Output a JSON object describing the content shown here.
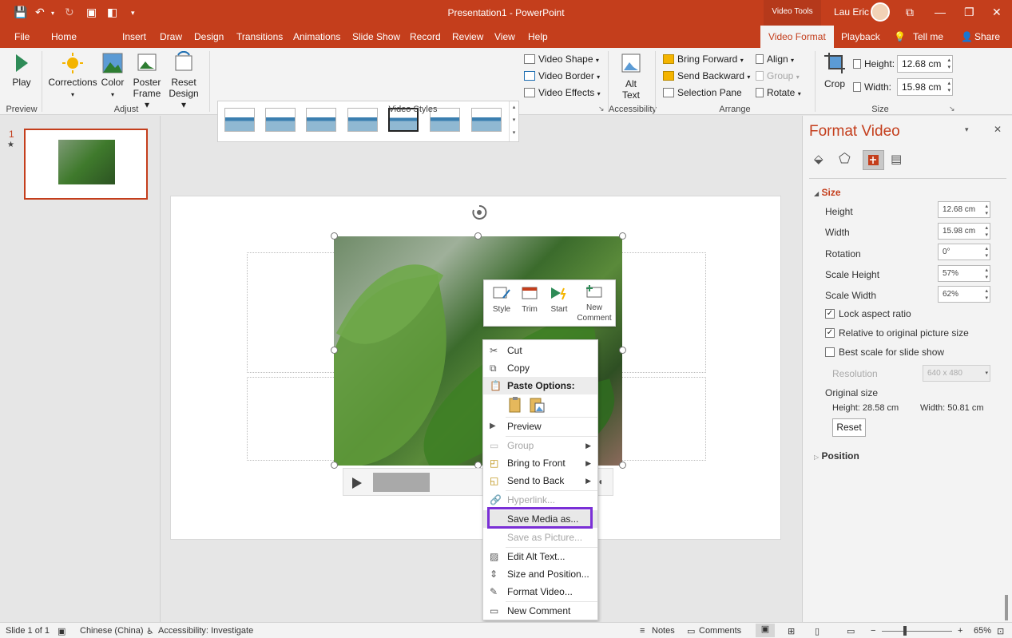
{
  "titlebar": {
    "title": "Presentation1  -  PowerPoint",
    "tools_label": "Video Tools",
    "user": "Lau Eric"
  },
  "tabs": [
    "File",
    "Home",
    "Insert",
    "Draw",
    "Design",
    "Transitions",
    "Animations",
    "Slide Show",
    "Record",
    "Review",
    "View",
    "Help"
  ],
  "tabs_right": {
    "video_format": "Video Format",
    "playback": "Playback",
    "tell_me": "Tell me",
    "share": "Share"
  },
  "ribbon": {
    "preview": {
      "play": "Play",
      "group": "Preview"
    },
    "adjust": {
      "corrections": "Corrections",
      "color": "Color",
      "poster_frame_1": "Poster",
      "poster_frame_2": "Frame",
      "reset_design_1": "Reset",
      "reset_design_2": "Design",
      "group": "Adjust"
    },
    "video_styles": {
      "group": "Video Styles",
      "video_shape": "Video Shape",
      "video_border": "Video Border",
      "video_effects": "Video Effects"
    },
    "accessibility": {
      "alt_text_1": "Alt",
      "alt_text_2": "Text",
      "group": "Accessibility"
    },
    "arrange": {
      "bring_forward": "Bring Forward",
      "send_backward": "Send Backward",
      "selection_pane": "Selection Pane",
      "align": "Align",
      "group_btn": "Group",
      "rotate": "Rotate",
      "group": "Arrange"
    },
    "size": {
      "crop": "Crop",
      "height_label": "Height:",
      "height_value": "12.68 cm",
      "width_label": "Width:",
      "width_value": "15.98 cm",
      "group": "Size"
    }
  },
  "thumbnails": {
    "slide_number": "1",
    "star": "★"
  },
  "mini_toolbar": {
    "style": "Style",
    "trim": "Trim",
    "start": "Start",
    "new_comment_1": "New",
    "new_comment_2": "Comment"
  },
  "context_menu": {
    "cut": "Cut",
    "copy": "Copy",
    "paste_options": "Paste Options:",
    "preview": "Preview",
    "group": "Group",
    "bring_to_front": "Bring to Front",
    "send_to_back": "Send to Back",
    "hyperlink": "Hyperlink...",
    "save_media_as": "Save Media as...",
    "save_as_picture": "Save as Picture...",
    "edit_alt_text": "Edit Alt Text...",
    "size_and_position": "Size and Position...",
    "format_video": "Format Video...",
    "new_comment": "New Comment"
  },
  "format_pane": {
    "title": "Format Video",
    "size_section": "Size",
    "height_label": "Height",
    "height_value": "12.68 cm",
    "width_label": "Width",
    "width_value": "15.98 cm",
    "rotation_label": "Rotation",
    "rotation_value": "0°",
    "scale_height_label": "Scale Height",
    "scale_height_value": "57%",
    "scale_width_label": "Scale Width",
    "scale_width_value": "62%",
    "lock_aspect": "Lock aspect ratio",
    "relative_original": "Relative to original picture size",
    "best_scale": "Best scale for slide show",
    "resolution_label": "Resolution",
    "resolution_value": "640 x 480",
    "original_size": "Original size",
    "orig_height_label": "Height:",
    "orig_height_value": "28.58 cm",
    "orig_width_label": "Width:",
    "orig_width_value": "50.81 cm",
    "reset": "Reset",
    "position_section": "Position"
  },
  "statusbar": {
    "slide": "Slide 1 of 1",
    "language": "Chinese (China)",
    "accessibility": "Accessibility: Investigate",
    "notes": "Notes",
    "comments": "Comments",
    "zoom": "65%"
  },
  "colors": {
    "accent": "#c43e1c",
    "highlight": "#7a2fd6"
  }
}
